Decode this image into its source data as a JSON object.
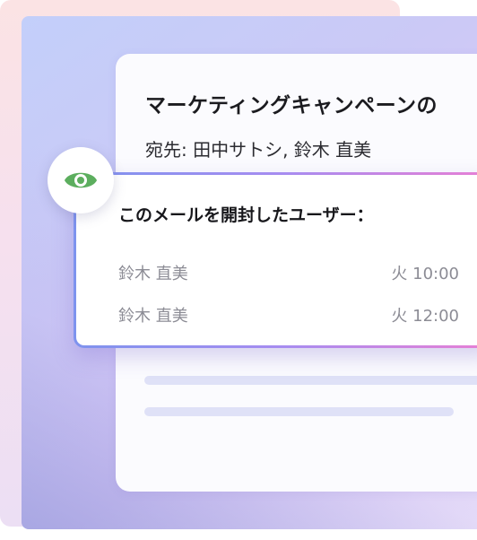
{
  "email": {
    "subject": "マーケティングキャンペーンの",
    "recipients": "宛先: 田中サトシ, 鈴木 直美"
  },
  "open_tracking": {
    "title": "このメールを開封したユーザー：",
    "icon": "eye-icon",
    "icon_color": "#5cae5e",
    "rows": [
      {
        "name": "鈴木 直美",
        "time": "火 10:00"
      },
      {
        "name": "鈴木 直美",
        "time": "火 12:00"
      }
    ]
  }
}
